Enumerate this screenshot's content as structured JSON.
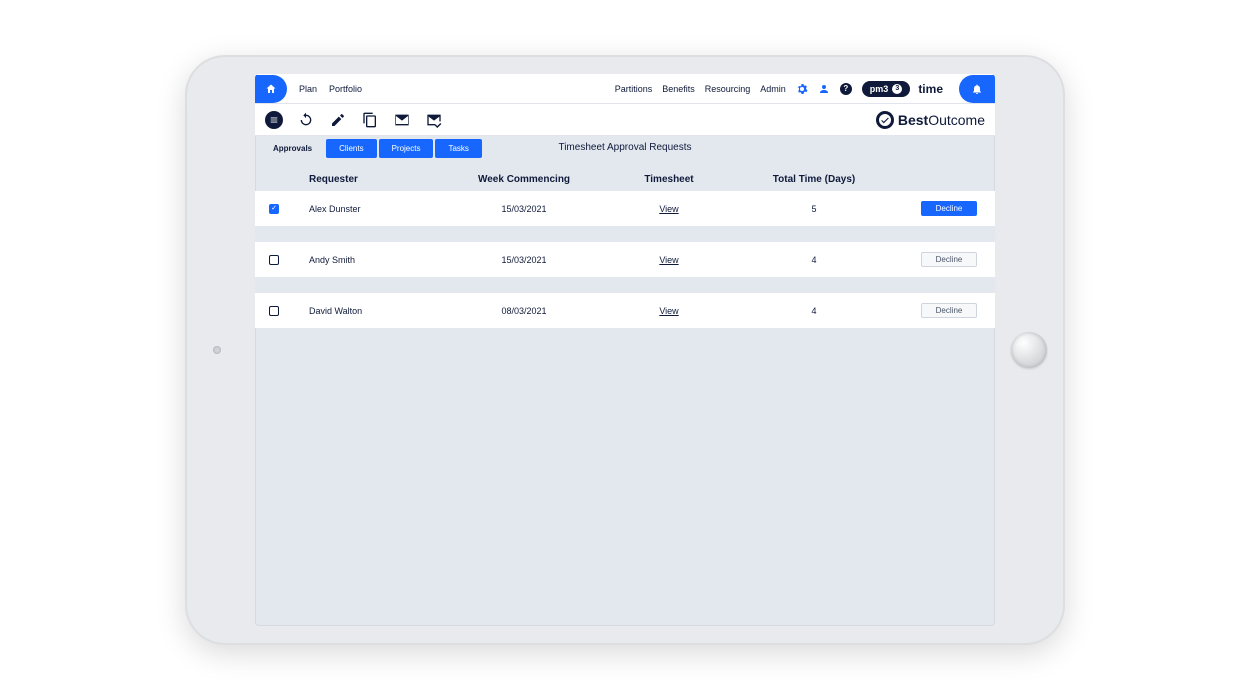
{
  "topnav": {
    "left": [
      "Plan",
      "Portfolio"
    ],
    "right": [
      "Partitions",
      "Benefits",
      "Resourcing",
      "Admin"
    ],
    "brand_pill": "pm3",
    "brand_time": "time"
  },
  "brand_logo": {
    "bold": "Best",
    "thin": "Outcome"
  },
  "tabs": [
    {
      "label": "Approvals",
      "style": "plain-active"
    },
    {
      "label": "Clients",
      "style": "blue"
    },
    {
      "label": "Projects",
      "style": "blue"
    },
    {
      "label": "Tasks",
      "style": "blue"
    }
  ],
  "page_title": "Timesheet Approval Requests",
  "columns": {
    "requester": "Requester",
    "week": "Week Commencing",
    "timesheet": "Timesheet",
    "total": "Total Time (Days)"
  },
  "view_label": "View",
  "decline_label": "Decline",
  "rows": [
    {
      "checked": true,
      "requester": "Alex Dunster",
      "week": "15/03/2021",
      "total": "5",
      "decline_style": "blue"
    },
    {
      "checked": false,
      "requester": "Andy Smith",
      "week": "15/03/2021",
      "total": "4",
      "decline_style": "plain"
    },
    {
      "checked": false,
      "requester": "David Walton",
      "week": "08/03/2021",
      "total": "4",
      "decline_style": "plain"
    }
  ]
}
